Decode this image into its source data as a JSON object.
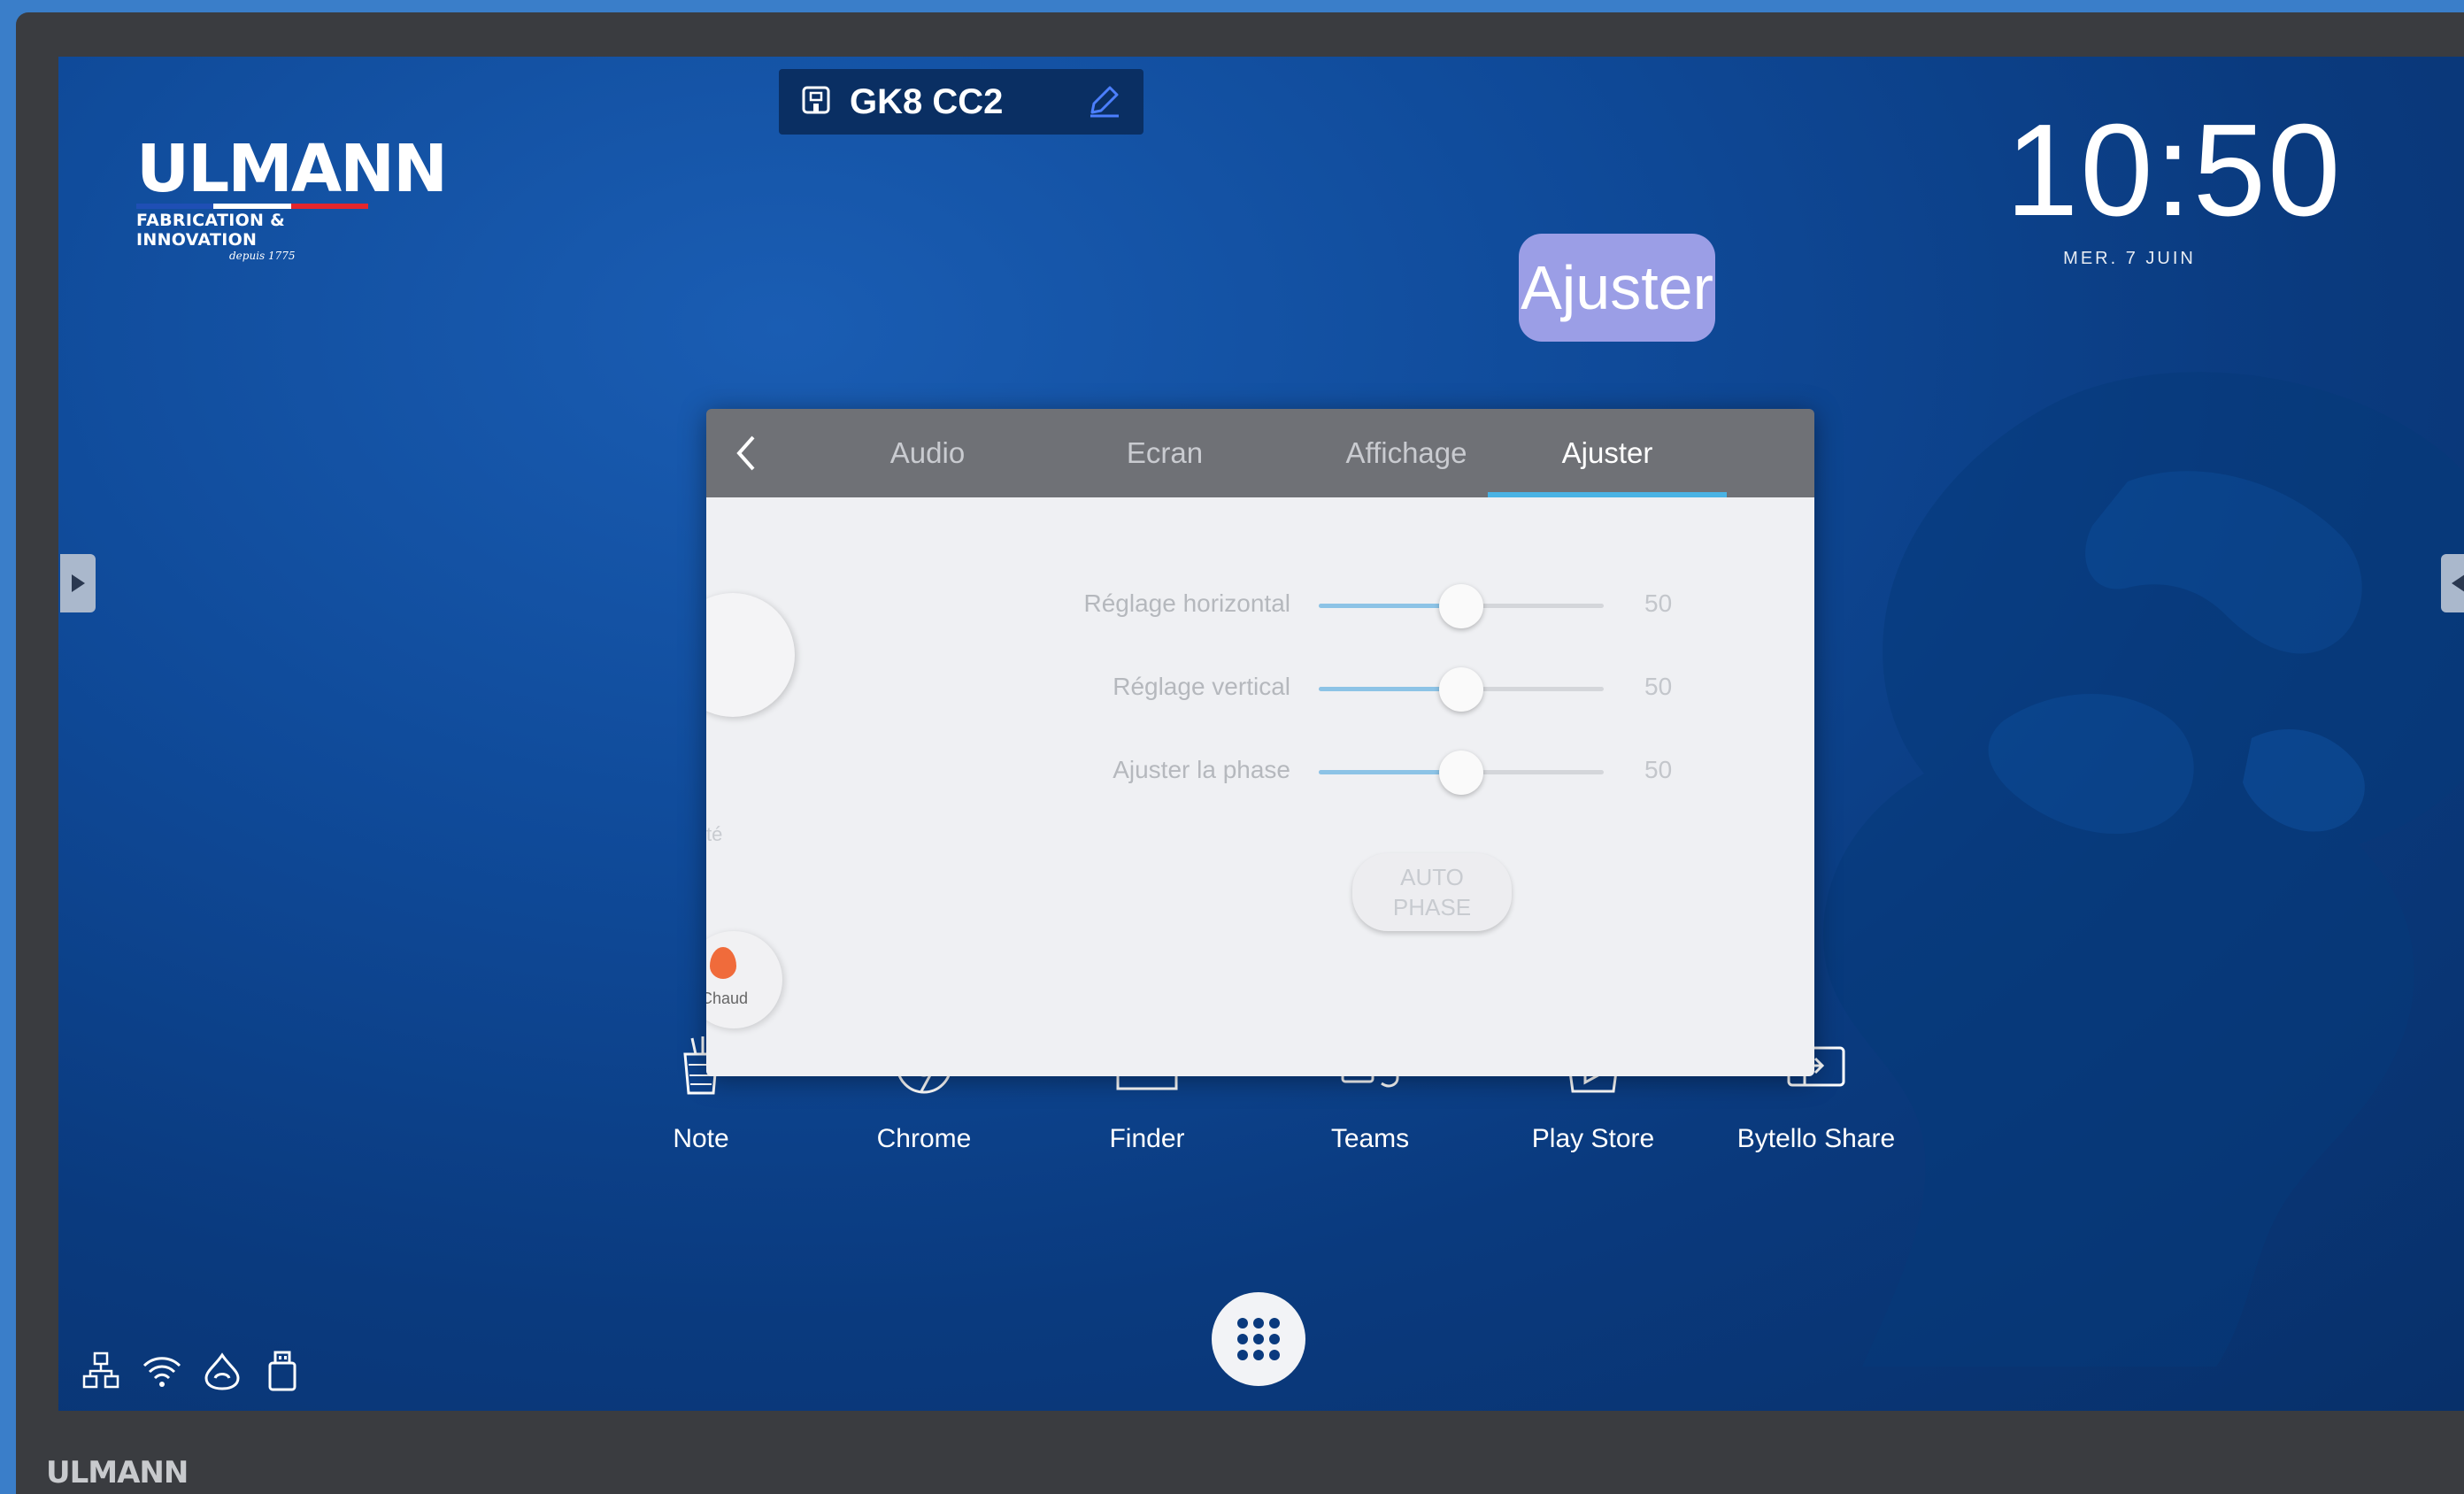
{
  "logo": {
    "word": "ULMANN",
    "subtitle": "FABRICATION & INNOVATION",
    "since": "depuis 1775"
  },
  "device": {
    "name": "GK8 CC2",
    "icon": "device-icon",
    "edit_icon": "pencil-icon"
  },
  "clock": {
    "time": "10:50",
    "date": "MER. 7 JUIN"
  },
  "tooltip": {
    "label": "Ajuster"
  },
  "panel": {
    "tabs": [
      {
        "label": "Audio",
        "active": false
      },
      {
        "label": "Ecran",
        "active": false
      },
      {
        "label": "Affichage",
        "active": false
      },
      {
        "label": "Ajuster",
        "active": true
      }
    ],
    "sliders": [
      {
        "label": "Réglage horizontal",
        "value": 50,
        "min": 0,
        "max": 100
      },
      {
        "label": "Réglage vertical",
        "value": 50,
        "min": 0,
        "max": 100
      },
      {
        "label": "Ajuster la phase",
        "value": 50,
        "min": 0,
        "max": 100
      }
    ],
    "auto_phase": {
      "line1": "AUTO",
      "line2": "PHASE"
    },
    "ghost": {
      "partial_label": "té",
      "chaud": "Chaud"
    }
  },
  "apps": [
    {
      "label": "Note",
      "icon": "note-icon"
    },
    {
      "label": "Chrome",
      "icon": "chrome-icon"
    },
    {
      "label": "Finder",
      "icon": "folder-icon"
    },
    {
      "label": "Teams",
      "icon": "teams-icon"
    },
    {
      "label": "Play Store",
      "icon": "play-store-icon"
    },
    {
      "label": "Bytello Share",
      "icon": "bytello-share-icon"
    }
  ],
  "status_icons": [
    "network-icon",
    "wifi-icon",
    "hotspot-icon",
    "usb-icon"
  ],
  "bezel_brand": "ULMANN",
  "colors": {
    "screen_bg": "#0f4a99",
    "tooltip": "#9b9ee6",
    "tab_underline": "#4ab3e4",
    "panel_header": "#6f7176"
  }
}
